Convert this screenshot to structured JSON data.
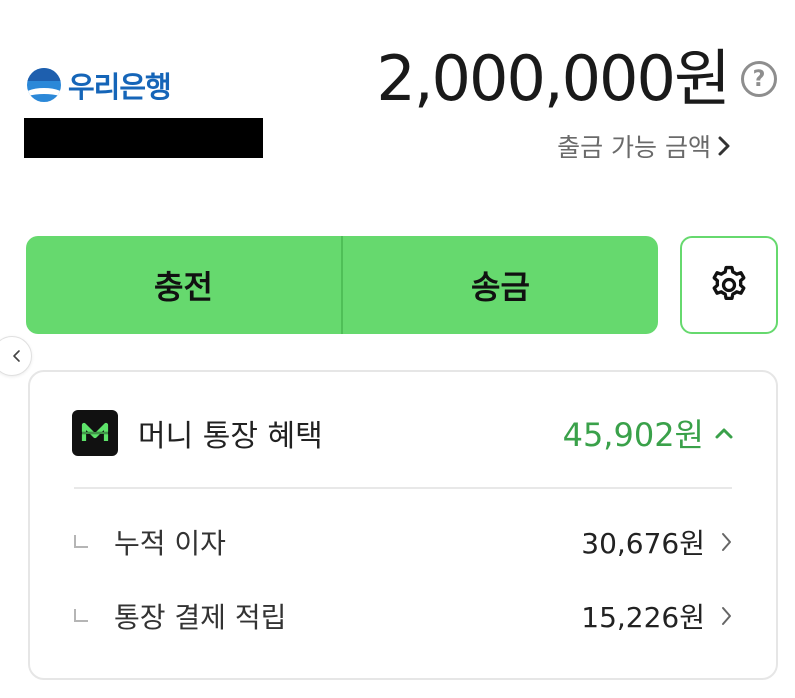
{
  "bank": {
    "name": "우리은행",
    "logo_icon": "woori-bank-logo-icon"
  },
  "balance": {
    "amount": "2,000,000원",
    "help_icon": "question-circle-icon",
    "help_symbol": "?",
    "withdrawable_label": "출금 가능 금액"
  },
  "actions": {
    "charge_label": "충전",
    "transfer_label": "송금",
    "settings_icon": "gear-icon"
  },
  "benefits": {
    "badge_icon": "money-m-logo-icon",
    "title": "머니 통장 혜택",
    "total": "45,902원",
    "items": [
      {
        "label": "누적 이자",
        "value": "30,676원"
      },
      {
        "label": "통장 결제 적립",
        "value": "15,226원"
      }
    ]
  },
  "colors": {
    "accent_green": "#66d96e",
    "benefit_text_green": "#3aa14a",
    "bank_blue": "#1565b8"
  }
}
